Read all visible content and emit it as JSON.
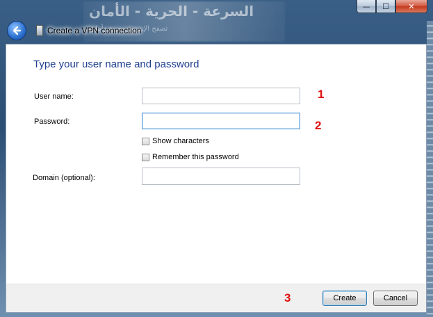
{
  "window": {
    "title": "Create a VPN connection",
    "background_text_line1": "السرعة - الحرية - الأمان",
    "background_text_line2": "تصفح الإنترنت بحرية وأمان"
  },
  "caption": {
    "minimize": "—",
    "maximize": "☐",
    "close": "✕"
  },
  "page": {
    "heading": "Type your user name and password"
  },
  "form": {
    "username_label": "User name:",
    "username_value": "",
    "password_label": "Password:",
    "password_value": "",
    "show_characters_label": "Show characters",
    "show_characters_checked": false,
    "remember_password_label": "Remember this password",
    "remember_password_checked": false,
    "domain_label": "Domain (optional):",
    "domain_value": ""
  },
  "annotations": {
    "n1": "1",
    "n2": "2",
    "n3": "3"
  },
  "footer": {
    "create_label": "Create",
    "cancel_label": "Cancel"
  },
  "colors": {
    "heading": "#1e3f8f",
    "annotation": "#e01010"
  }
}
